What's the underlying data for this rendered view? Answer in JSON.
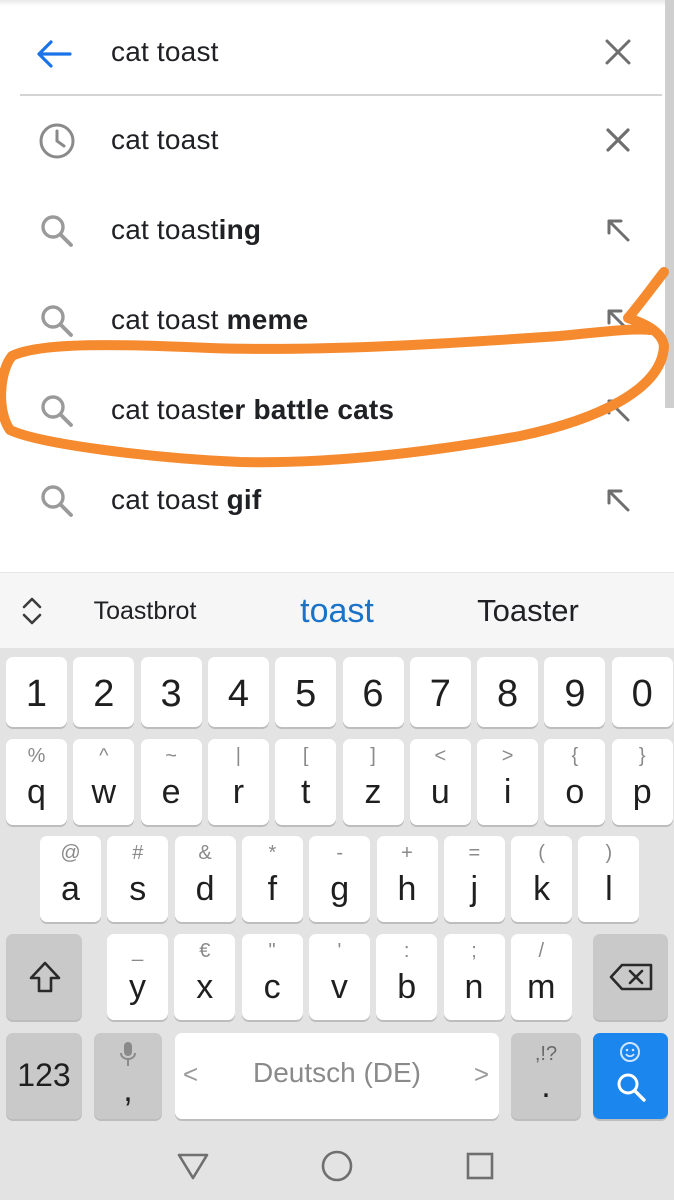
{
  "search": {
    "query": "cat toast"
  },
  "suggestions": [
    {
      "type": "history",
      "prefix": "cat toast",
      "bold": ""
    },
    {
      "type": "suggest",
      "prefix": "cat toast",
      "bold": "ing"
    },
    {
      "type": "suggest",
      "prefix": "cat toast ",
      "bold": "meme"
    },
    {
      "type": "suggest",
      "prefix": "cat toast",
      "bold": "er battle cats"
    },
    {
      "type": "suggest",
      "prefix": "cat toast ",
      "bold": "gif"
    }
  ],
  "annotation": {
    "color": "#f58a2f",
    "circled_item": "cat toaster battle cats"
  },
  "keyboard": {
    "suggestions": {
      "left": "Toastbrot",
      "middle": "toast",
      "right": "Toaster"
    },
    "number_row": [
      "1",
      "2",
      "3",
      "4",
      "5",
      "6",
      "7",
      "8",
      "9",
      "0"
    ],
    "row1": [
      {
        "main": "q",
        "sub": "%"
      },
      {
        "main": "w",
        "sub": "^"
      },
      {
        "main": "e",
        "sub": "~"
      },
      {
        "main": "r",
        "sub": "|"
      },
      {
        "main": "t",
        "sub": "["
      },
      {
        "main": "z",
        "sub": "]"
      },
      {
        "main": "u",
        "sub": "<"
      },
      {
        "main": "i",
        "sub": ">"
      },
      {
        "main": "o",
        "sub": "{"
      },
      {
        "main": "p",
        "sub": "}"
      }
    ],
    "row2": [
      {
        "main": "a",
        "sub": "@"
      },
      {
        "main": "s",
        "sub": "#"
      },
      {
        "main": "d",
        "sub": "&"
      },
      {
        "main": "f",
        "sub": "*"
      },
      {
        "main": "g",
        "sub": "-"
      },
      {
        "main": "h",
        "sub": "+"
      },
      {
        "main": "j",
        "sub": "="
      },
      {
        "main": "k",
        "sub": "("
      },
      {
        "main": "l",
        "sub": ")"
      }
    ],
    "row3": [
      {
        "main": "y",
        "sub": "_"
      },
      {
        "main": "x",
        "sub": "€"
      },
      {
        "main": "c",
        "sub": "\""
      },
      {
        "main": "v",
        "sub": "'"
      },
      {
        "main": "b",
        "sub": ":"
      },
      {
        "main": "n",
        "sub": ";"
      },
      {
        "main": "m",
        "sub": "/"
      }
    ],
    "numbers_key": "123",
    "comma_key": ",",
    "space_label": "Deutsch (DE)",
    "space_left": "<",
    "space_right": ">",
    "period_key": ".",
    "period_sub": ",!?",
    "accent_color": "#1a86ee"
  }
}
